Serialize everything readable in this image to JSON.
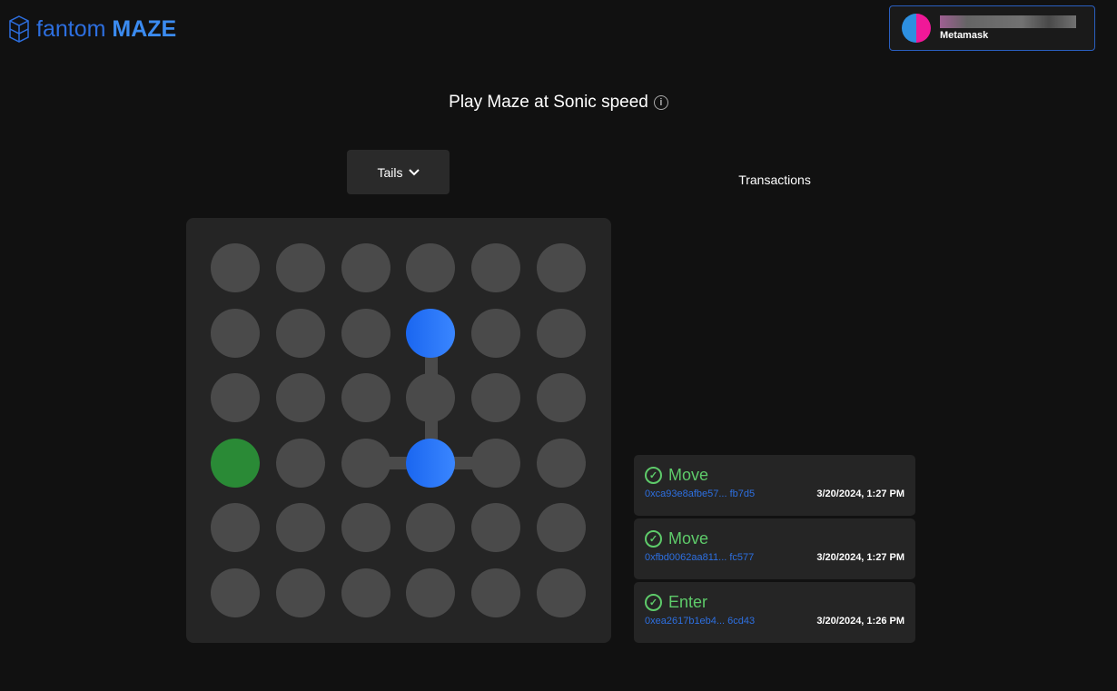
{
  "header": {
    "logo_light": "fantom",
    "logo_bold": "MAZE",
    "wallet_name": "Metamask"
  },
  "title": "Play Maze at Sonic speed",
  "select": {
    "value": "Tails"
  },
  "transactions_title": "Transactions",
  "board": {
    "rows": 6,
    "cols": 6,
    "blue": [
      [
        1,
        3
      ],
      [
        3,
        3
      ]
    ],
    "green": [
      [
        3,
        0
      ]
    ],
    "colors": {
      "blue": "#2a7aff",
      "green": "#2a8a36",
      "empty": "#4a4a4a"
    }
  },
  "transactions": [
    {
      "type": "Move",
      "hash": "0xca93e8afbe57... fb7d5",
      "time": "3/20/2024, 1:27 PM"
    },
    {
      "type": "Move",
      "hash": "0xfbd0062aa811... fc577",
      "time": "3/20/2024, 1:27 PM"
    },
    {
      "type": "Enter",
      "hash": "0xea2617b1eb4... 6cd43",
      "time": "3/20/2024, 1:26 PM"
    }
  ]
}
